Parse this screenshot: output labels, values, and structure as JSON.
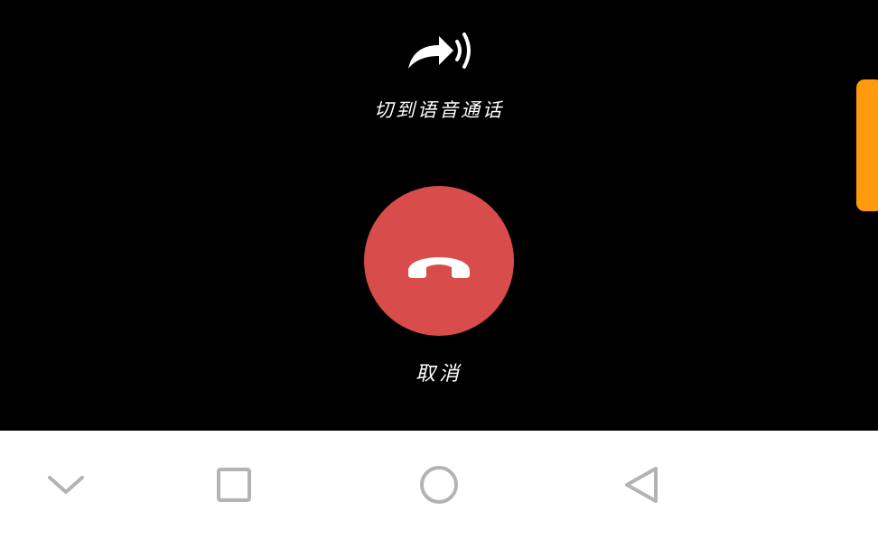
{
  "call": {
    "switch_voice_label": "切到语音通话",
    "switch_voice_icon": "forward-sound-icon",
    "hangup_icon": "phone-hangup-icon",
    "cancel_label": "取消"
  },
  "nav": {
    "icons": [
      "chevron-down-icon",
      "square-recent-icon",
      "circle-home-icon",
      "triangle-back-icon"
    ]
  },
  "colors": {
    "background": "#000000",
    "hangup": "#d94c4c",
    "side_tab": "#ff9a0f",
    "nav_bar": "#ffffff",
    "nav_icon": "#b3b3b3",
    "text": "#ffffff"
  }
}
